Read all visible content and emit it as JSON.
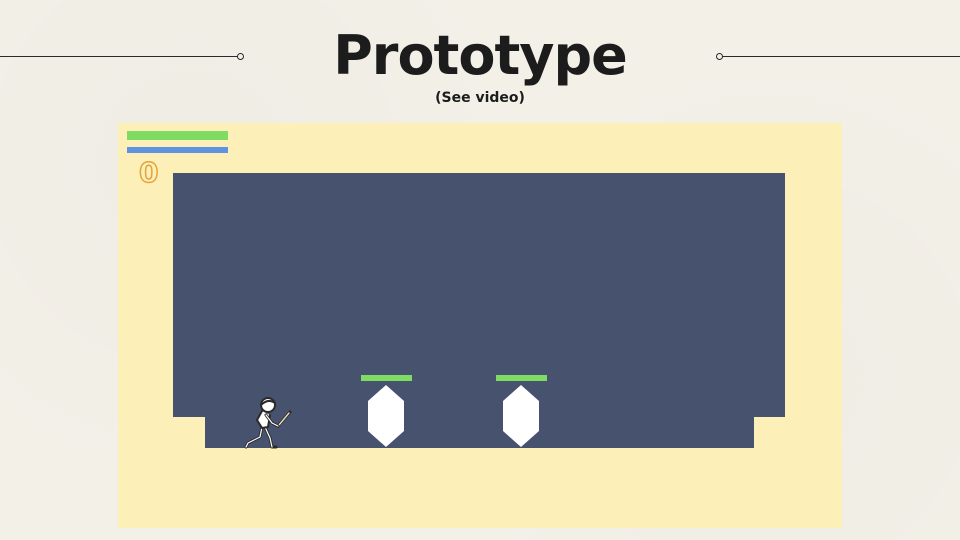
{
  "slide": {
    "title": "Prototype",
    "subtitle": "(See video)"
  },
  "game": {
    "hud": {
      "score": "0",
      "health_fraction": 1.0,
      "mana_fraction": 1.0,
      "health_color": "#7fdc63",
      "mana_color": "#5f93e2",
      "score_color": "#e3a33a"
    },
    "colors": {
      "background": "#fdefb8",
      "wall": "#47526f",
      "enemy": "#ffffff",
      "enemy_health": "#7fdc63"
    },
    "enemies": [
      {
        "shape": "hexagon",
        "health_fraction": 1.0
      },
      {
        "shape": "hexagon",
        "health_fraction": 1.0
      }
    ],
    "player": {
      "sprite": "stick-figure-with-sword"
    }
  }
}
